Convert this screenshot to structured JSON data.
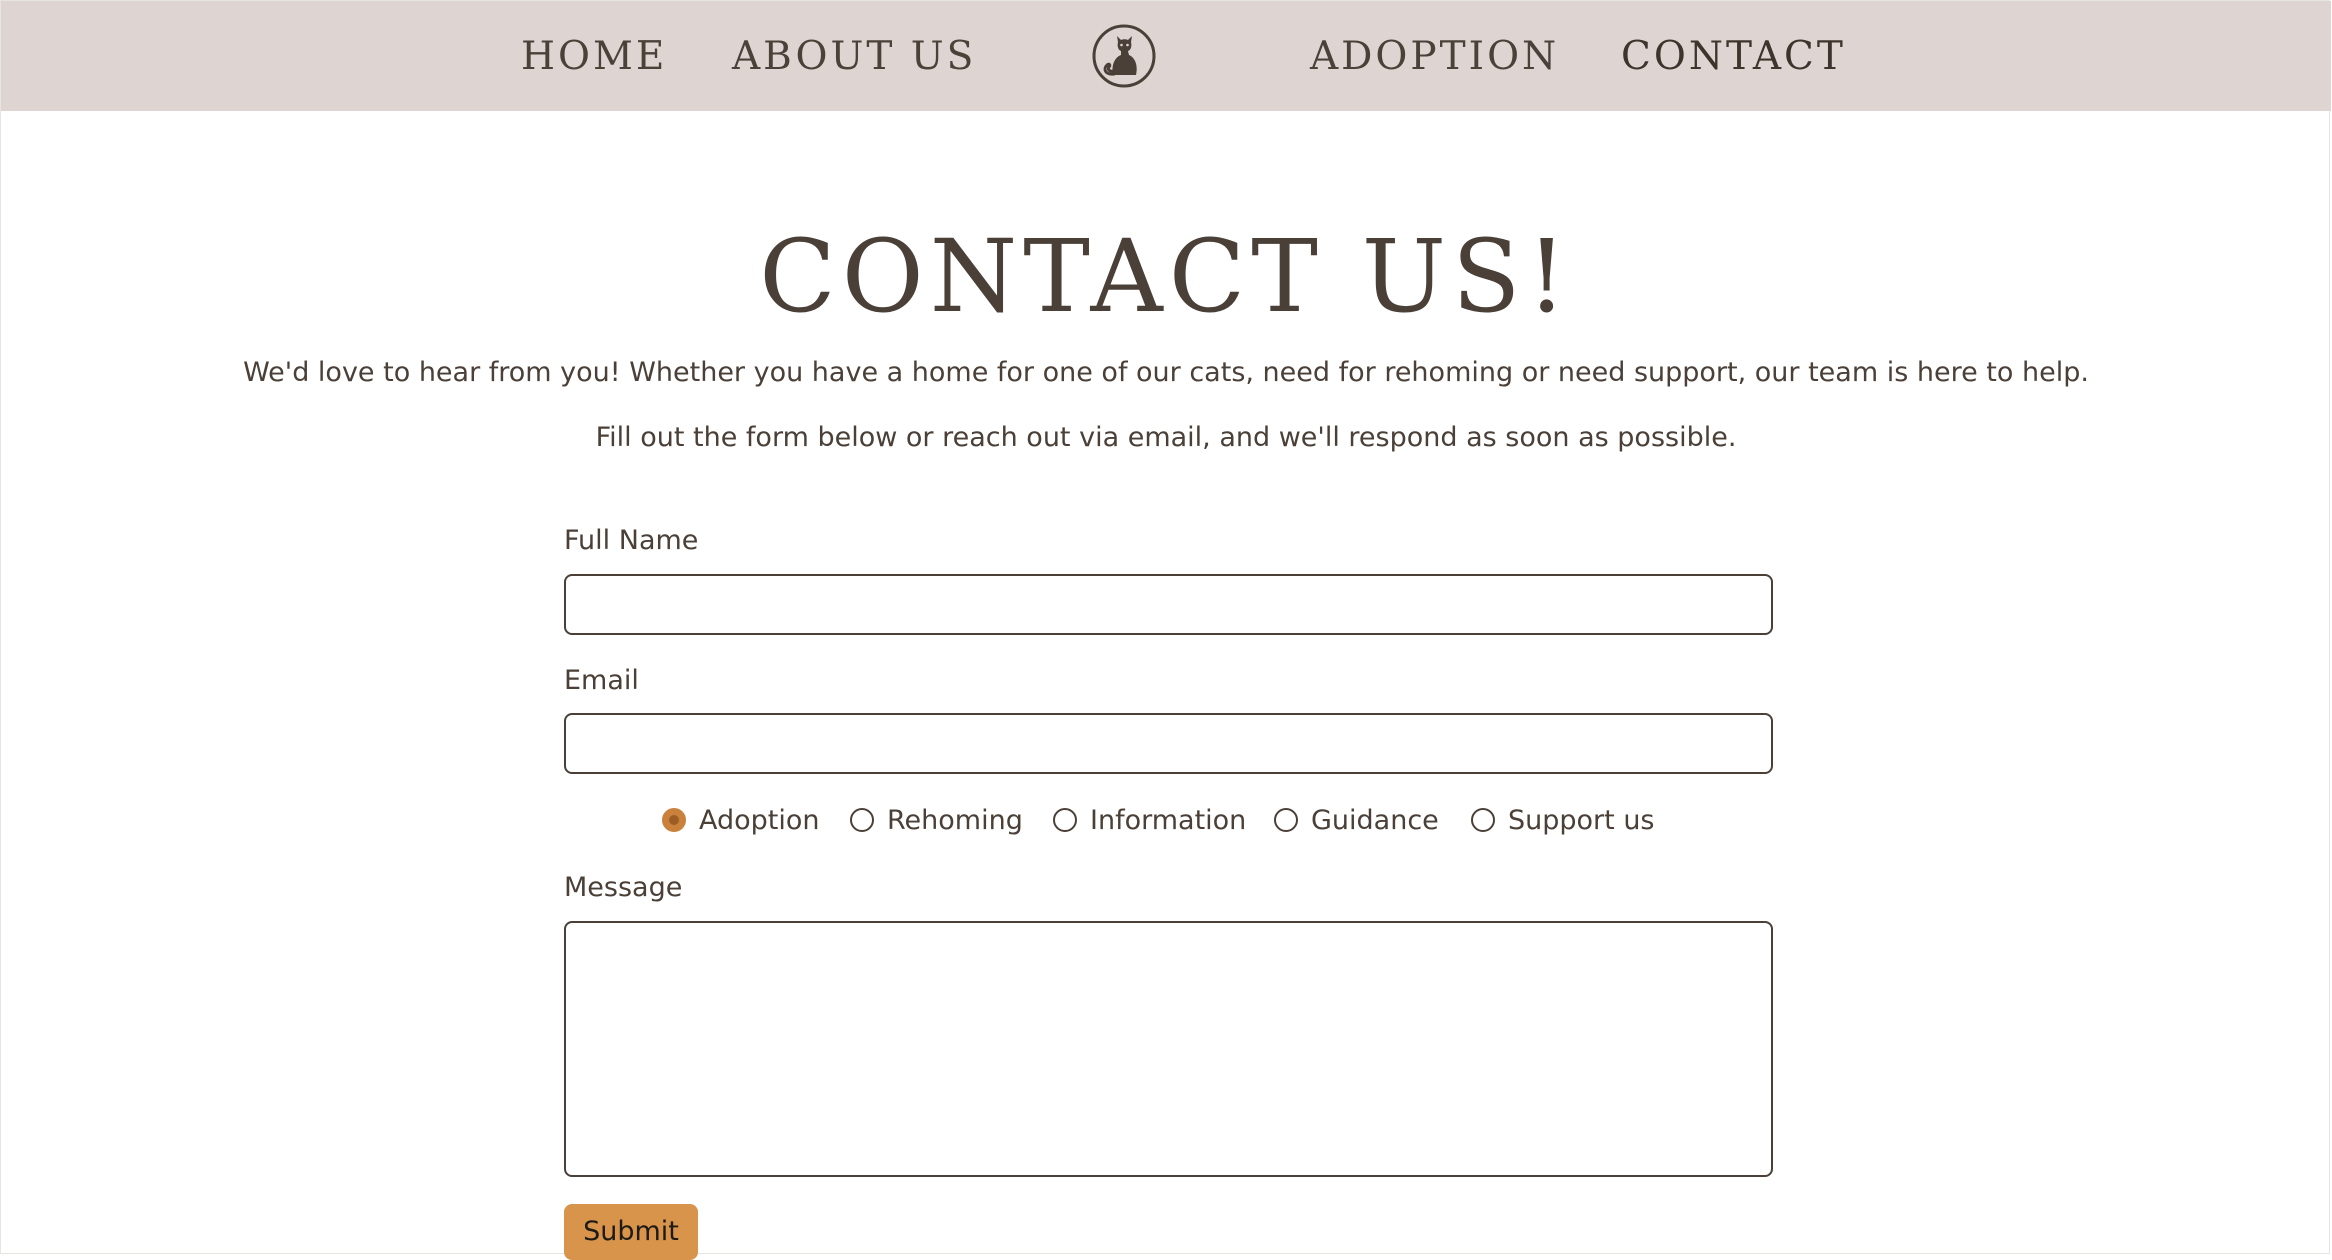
{
  "nav": {
    "home": "HOME",
    "about": "ABOUT US",
    "adoption": "ADOPTION",
    "contact": "CONTACT",
    "logo_icon": "cat-logo-icon"
  },
  "page": {
    "title": "CONTACT US!",
    "intro_line_1": "We'd love to hear from you! Whether you have a home for one of our cats, need for rehoming or need support, our team is here to help.",
    "intro_line_2": "Fill out the form below or reach out via email, and we'll respond as soon as possible."
  },
  "form": {
    "full_name_label": "Full Name",
    "full_name_value": "",
    "email_label": "Email",
    "email_value": "",
    "topics": [
      {
        "label": "Adoption",
        "selected": true
      },
      {
        "label": "Rehoming",
        "selected": false
      },
      {
        "label": "Information",
        "selected": false
      },
      {
        "label": "Guidance",
        "selected": false
      },
      {
        "label": "Support us",
        "selected": false
      }
    ],
    "message_label": "Message",
    "message_value": "",
    "submit_label": "Submit"
  },
  "colors": {
    "nav_background": "#ded5d3",
    "text": "#4a4038",
    "accent": "#c9813b",
    "button": "#d7944a"
  }
}
